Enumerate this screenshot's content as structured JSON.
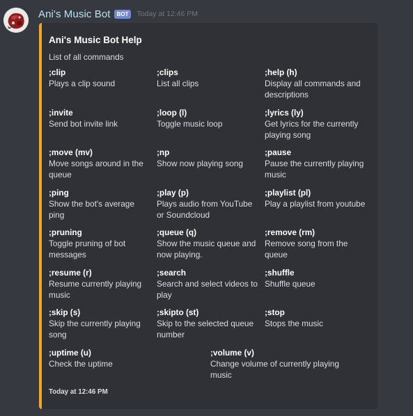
{
  "message": {
    "username": "Ani's Music Bot",
    "bot_tag": "BOT",
    "timestamp": "Today at 12:46 PM",
    "avatar_icon": "bot-avatar-icon"
  },
  "embed": {
    "accent_color": "#f5a623",
    "title": "Ani's Music Bot Help",
    "description": "List of all commands",
    "fields": [
      {
        "name": ";clip",
        "value": "Plays a clip sound"
      },
      {
        "name": ";clips",
        "value": "List all clips"
      },
      {
        "name": ";help (h)",
        "value": "Display all commands and descriptions"
      },
      {
        "name": ";invite",
        "value": "Send bot invite link"
      },
      {
        "name": ";loop (l)",
        "value": "Toggle music loop"
      },
      {
        "name": ";lyrics (ly)",
        "value": "Get lyrics for the currently playing song"
      },
      {
        "name": ";move (mv)",
        "value": "Move songs around in the queue"
      },
      {
        "name": ";np",
        "value": "Show now playing song"
      },
      {
        "name": ";pause",
        "value": "Pause the currently playing music"
      },
      {
        "name": ";ping",
        "value": "Show the bot's average ping"
      },
      {
        "name": ";play (p)",
        "value": "Plays audio from YouTube or Soundcloud"
      },
      {
        "name": ";playlist (pl)",
        "value": "Play a playlist from youtube"
      },
      {
        "name": ";pruning",
        "value": "Toggle pruning of bot messages"
      },
      {
        "name": ";queue (q)",
        "value": "Show the music queue and now playing."
      },
      {
        "name": ";remove (rm)",
        "value": "Remove song from the queue"
      },
      {
        "name": ";resume (r)",
        "value": "Resume currently playing music"
      },
      {
        "name": ";search",
        "value": "Search and select videos to play"
      },
      {
        "name": ";shuffle",
        "value": "Shuffle queue"
      },
      {
        "name": ";skip (s)",
        "value": "Skip the currently playing song"
      },
      {
        "name": ";skipto (st)",
        "value": "Skip to the selected queue number"
      },
      {
        "name": ";stop",
        "value": "Stops the music"
      },
      {
        "name": ";uptime (u)",
        "value": "Check the uptime"
      },
      {
        "name": ";volume (v)",
        "value": "Change volume of currently playing music"
      }
    ],
    "footer": "Today at 12:46 PM"
  }
}
